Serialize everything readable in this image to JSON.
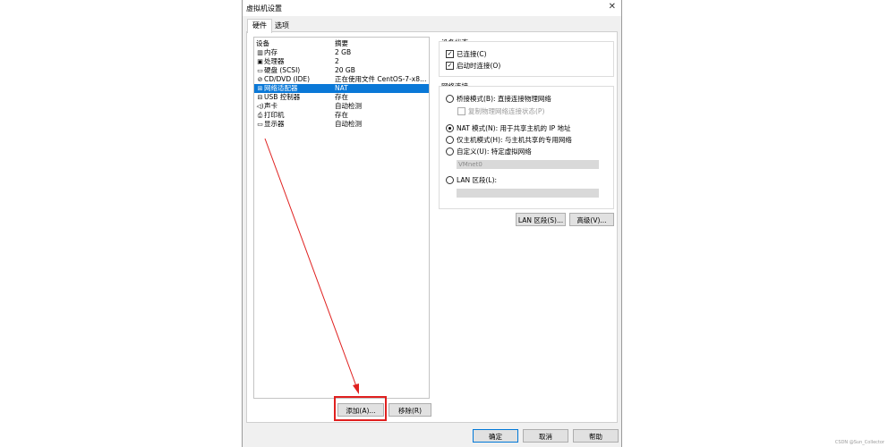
{
  "window": {
    "title": "虚拟机设置"
  },
  "tabs": [
    {
      "label": "硬件"
    },
    {
      "label": "选项"
    }
  ],
  "device_list": {
    "headers": {
      "device": "设备",
      "summary": "摘要"
    },
    "items": [
      {
        "icon": "memory-icon",
        "name": "内存",
        "summary": "2 GB"
      },
      {
        "icon": "processor-icon",
        "name": "处理器",
        "summary": "2"
      },
      {
        "icon": "hard-disk-icon",
        "name": "硬盘 (SCSI)",
        "summary": "20 GB"
      },
      {
        "icon": "cd-dvd-icon",
        "name": "CD/DVD (IDE)",
        "summary": "正在使用文件 CentOS-7-x86_..."
      },
      {
        "icon": "network-adapter-icon",
        "name": "网络适配器",
        "summary": "NAT",
        "selected": true
      },
      {
        "icon": "usb-icon",
        "name": "USB 控制器",
        "summary": "存在"
      },
      {
        "icon": "sound-card-icon",
        "name": "声卡",
        "summary": "自动检测"
      },
      {
        "icon": "printer-icon",
        "name": "打印机",
        "summary": "存在"
      },
      {
        "icon": "display-icon",
        "name": "显示器",
        "summary": "自动检测"
      }
    ]
  },
  "buttons": {
    "add": "添加(A)...",
    "remove": "移除(R)",
    "ok": "确定",
    "cancel": "取消",
    "help": "帮助",
    "lan_segments": "LAN 区段(S)...",
    "advanced": "高级(V)..."
  },
  "device_status": {
    "label": "设备状态",
    "connected": {
      "label": "已连接(C)",
      "checked": true
    },
    "connect_at_power_on": {
      "label": "启动时连接(O)",
      "checked": true
    }
  },
  "network_connection": {
    "label": "网络连接",
    "bridged": {
      "label": "桥接模式(B): 直接连接物理网络",
      "checked": false
    },
    "replicate": {
      "label": "复制物理网络连接状态(P)",
      "checked": false
    },
    "nat": {
      "label": "NAT 模式(N): 用于共享主机的 IP 地址",
      "checked": true
    },
    "host_only": {
      "label": "仅主机模式(H): 与主机共享的专用网络",
      "checked": false
    },
    "custom": {
      "label": "自定义(U): 特定虚拟网络",
      "checked": false
    },
    "custom_value": "VMnet0",
    "lan_segment": {
      "label": "LAN 区段(L):",
      "checked": false
    },
    "lan_segment_value": ""
  },
  "watermark": "CSDN @Sun_Collector",
  "colors": {
    "selection": "#0a78d7",
    "annotation": "#e0201f"
  }
}
